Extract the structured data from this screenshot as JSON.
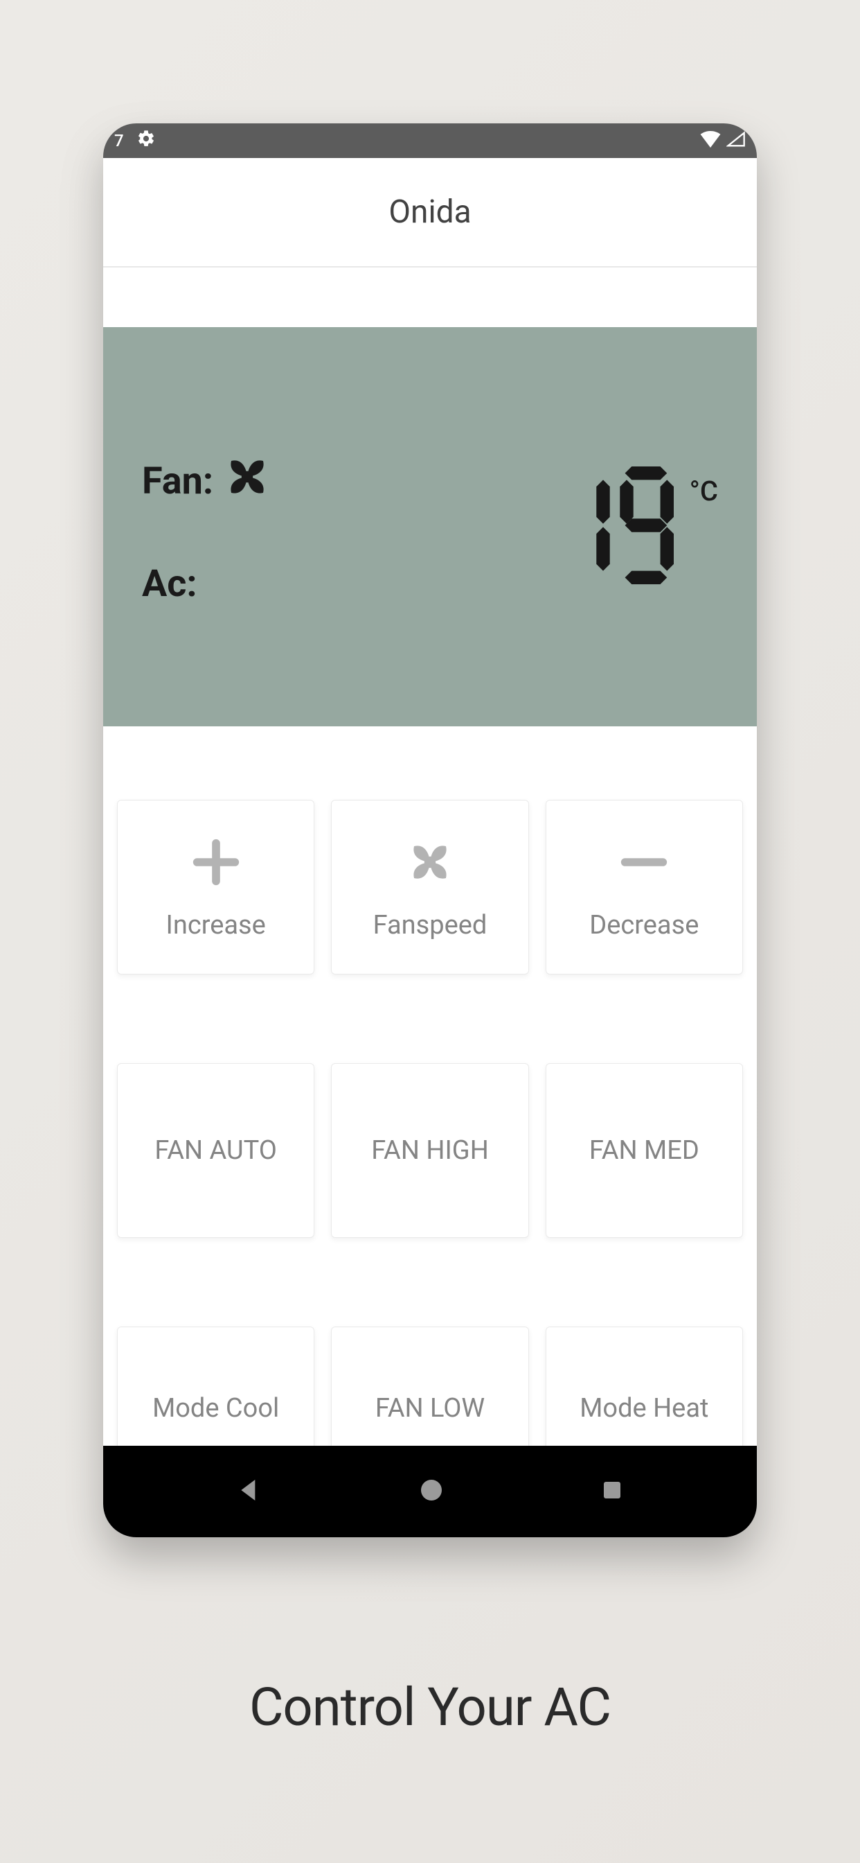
{
  "status": {
    "time_fragment": "7"
  },
  "header": {
    "title": "Onida"
  },
  "display": {
    "fan_label": "Fan: ",
    "ac_label": "Ac: ",
    "temperature": "19",
    "unit": "°C"
  },
  "controls": {
    "increase": "Increase",
    "fanspeed": "Fanspeed",
    "decrease": "Decrease",
    "fan_auto": "FAN AUTO",
    "fan_high": "FAN HIGH",
    "fan_med": "FAN MED",
    "mode_cool": "Mode Cool",
    "fan_low": "FAN LOW",
    "mode_heat": "Mode Heat"
  },
  "caption": "Control Your AC"
}
